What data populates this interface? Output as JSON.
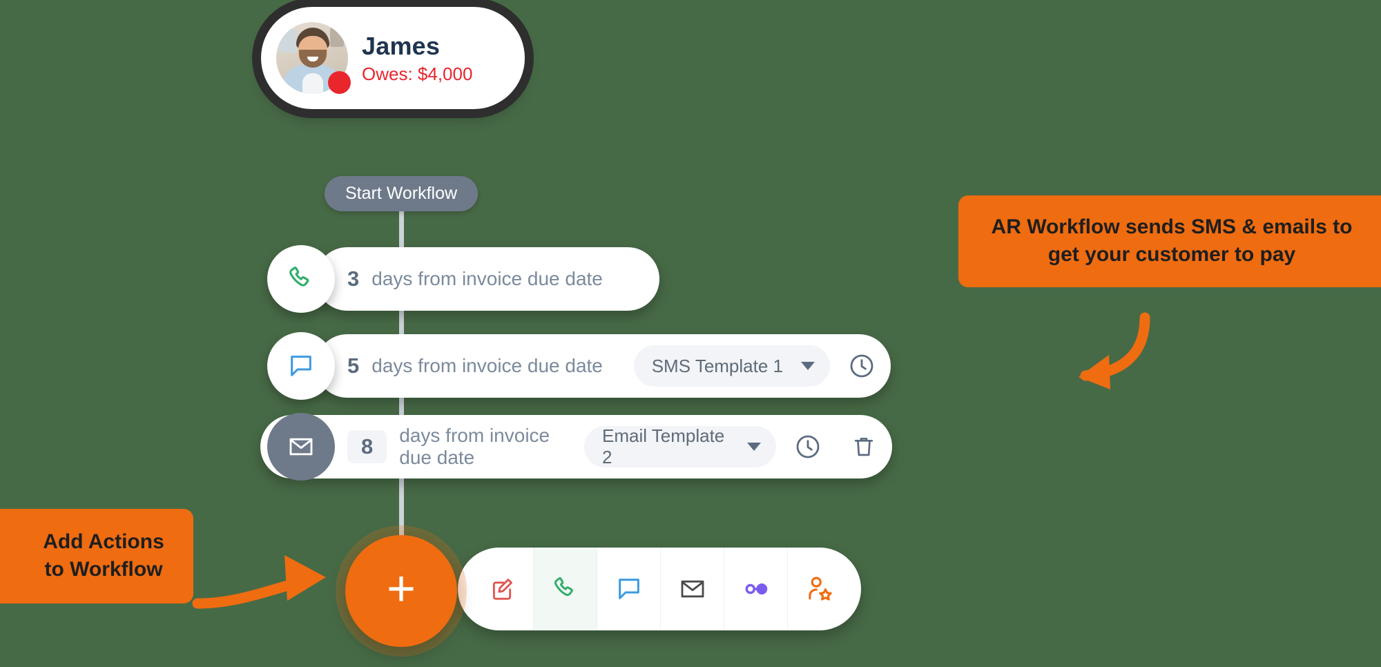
{
  "contact": {
    "name": "James",
    "owes": "Owes: $4,000",
    "status_color": "#e8262c",
    "avatar_icon": "user-photo"
  },
  "workflow": {
    "start_label": "Start Workflow",
    "rows": [
      {
        "icon": "phone-icon",
        "icon_color": "#2fae6a",
        "days": "3",
        "label": "days from invoice due date",
        "template": null,
        "has_clock": false,
        "has_delete": false
      },
      {
        "icon": "chat-bubble-icon",
        "icon_color": "#3b9ae1",
        "days": "5",
        "label": "days from invoice due date",
        "template": "SMS Template 1",
        "has_clock": true,
        "has_delete": false
      },
      {
        "icon": "envelope-icon",
        "icon_color": "#ffffff",
        "days": "8",
        "label": "days from invoice due date",
        "template": "Email Template 2",
        "has_clock": true,
        "has_delete": true
      }
    ]
  },
  "add_button": {
    "glyph": "+",
    "name": "add-action-button",
    "color": "#ef6c11"
  },
  "action_toolbar": {
    "items": [
      {
        "name": "edit-note-icon",
        "color": "#e0554e"
      },
      {
        "name": "phone-call-icon",
        "color": "#2fae6a"
      },
      {
        "name": "sms-chat-icon",
        "color": "#3b9ae1"
      },
      {
        "name": "email-icon",
        "color": "#4a4a4a"
      },
      {
        "name": "connector-toggle-icon",
        "color": "#7c5cf0"
      },
      {
        "name": "assign-user-star-icon",
        "color": "#ef6c11"
      }
    ]
  },
  "callouts": {
    "right": "AR Workflow sends SMS & emails to get your customer to pay",
    "left": "Add Actions to Workflow",
    "accent": "#ef6c11"
  }
}
